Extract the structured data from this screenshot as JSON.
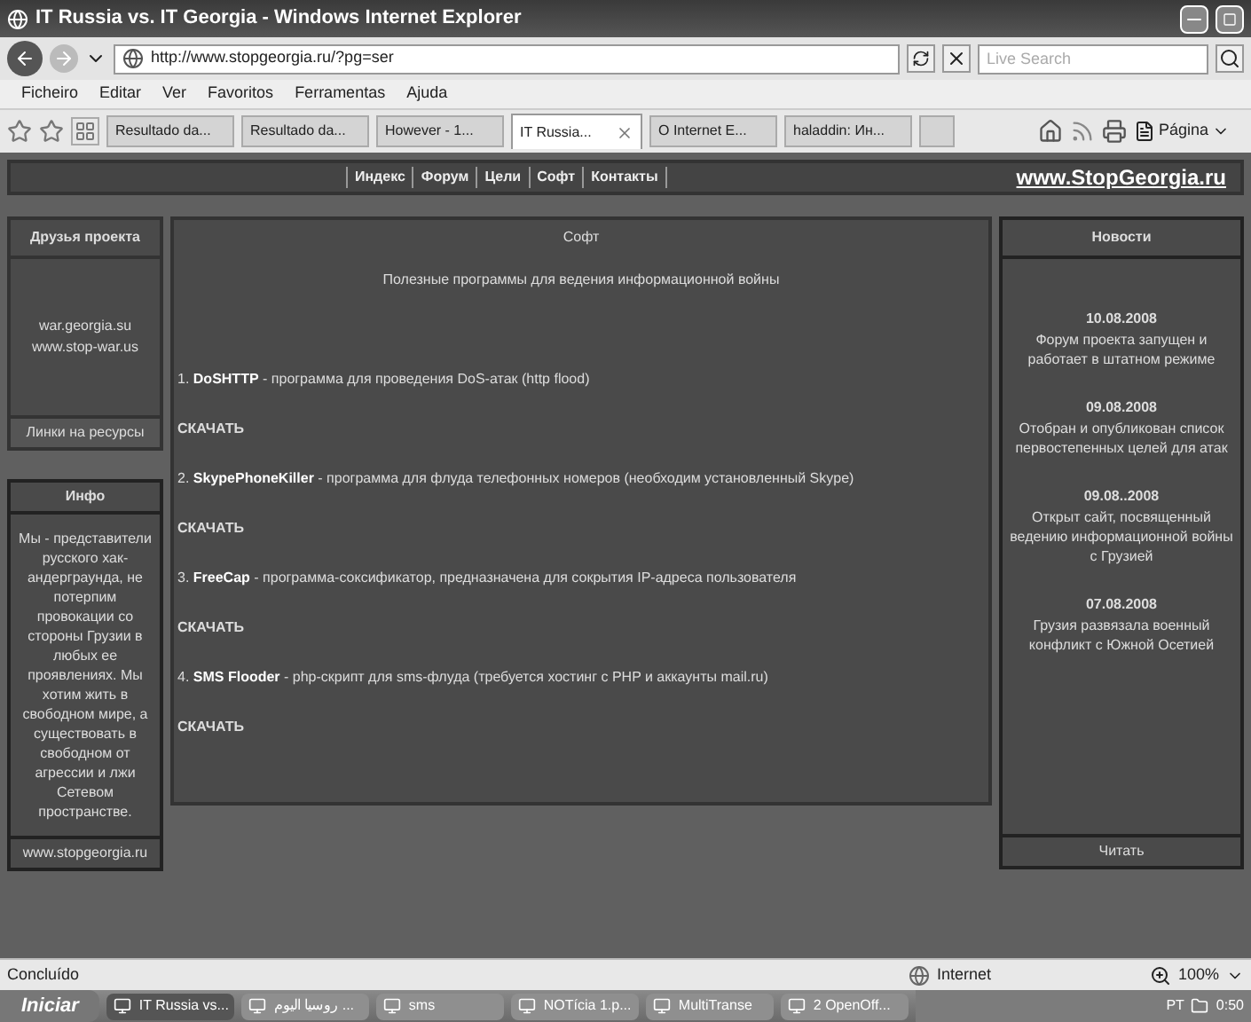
{
  "window": {
    "title": "IT Russia vs. IT Georgia - Windows Internet Explorer"
  },
  "address_bar": {
    "url": "http://www.stopgeorgia.ru/?pg=ser"
  },
  "search": {
    "placeholder": "Live Search"
  },
  "menu": [
    "Ficheiro",
    "Editar",
    "Ver",
    "Favoritos",
    "Ferramentas",
    "Ajuda"
  ],
  "tabs": [
    {
      "label": "Resultado da...",
      "selected": false
    },
    {
      "label": "Resultado da...",
      "selected": false
    },
    {
      "label": "However - 1...",
      "selected": false
    },
    {
      "label": "IT Russia...",
      "selected": true
    },
    {
      "label": "O Internet E...",
      "selected": false
    },
    {
      "label": "haladdin: Ин...",
      "selected": false
    }
  ],
  "page_menu": "Página",
  "site": {
    "nav": [
      "Индекс",
      "Форум",
      "Цели",
      "Софт",
      "Контакты"
    ],
    "logo": "www.StopGeorgia.ru",
    "friends": {
      "title": "Друзья проекта",
      "links": [
        "war.georgia.su",
        "www.stop-war.us"
      ],
      "footer": "Линки на ресурсы"
    },
    "info": {
      "title": "Инфо",
      "text": "Мы - представители русского хак-андерграунда, не потерпим провокации со стороны Грузии в любых ее проявлениях. Мы хотим жить в свободном мире, а существовать в свободном от агрессии и лжи Сетевом пространстве.",
      "footer": "www.stopgeorgia.ru"
    },
    "main": {
      "title": "Софт",
      "subtitle": "Полезные программы для ведения информационной войны",
      "programs": [
        {
          "text": "1. **DoSHTTP** - программа для проведения DoS-атак (http flood)",
          "download": "СКАЧАТЬ"
        },
        {
          "text": "2. **SkypePhoneKiller** - программа для флуда телефонных номеров (необходим установленный Skype)",
          "download": "СКАЧАТЬ"
        },
        {
          "text": "3. **FreeCap** - программа-соксификатор, предназначена для сокрытия IP-адреса пользователя",
          "download": "СКАЧАТЬ"
        },
        {
          "text": "4. **SMS Flooder** - php-скрипт для sms-флуда (требуется хостинг с PHP и аккаунты mail.ru)",
          "download": "СКАЧАТЬ"
        }
      ]
    },
    "news": {
      "title": "Новости",
      "items": [
        {
          "date": "10.08.2008",
          "text": "Форум проекта запущен и работает в штатном режиме"
        },
        {
          "date": "09.08.2008",
          "text": "Отобран и опубликован список первостепенных целей для атак"
        },
        {
          "date": "09.08..2008",
          "text": "Открыт сайт, посвященный ведению информационной войны с Грузией"
        },
        {
          "date": "07.08.2008",
          "text": "Грузия развязала военный конфликт с Южной Осетией"
        }
      ],
      "footer": "Читать"
    }
  },
  "status_bar": {
    "text": "Concluído",
    "zone": "Internet",
    "zoom": "100%"
  },
  "taskbar": {
    "start": "Iniciar",
    "items": [
      {
        "label": "IT Russia vs...",
        "selected": true
      },
      {
        "label": "روسيا اليوم ...",
        "selected": false
      },
      {
        "label": "sms",
        "selected": false
      },
      {
        "label": "NOTícia 1.p...",
        "selected": false
      },
      {
        "label": "MultiTranse",
        "selected": false
      },
      {
        "label": "2 OpenOff...",
        "selected": false
      }
    ],
    "lang": "PT",
    "clock": "0:50"
  }
}
